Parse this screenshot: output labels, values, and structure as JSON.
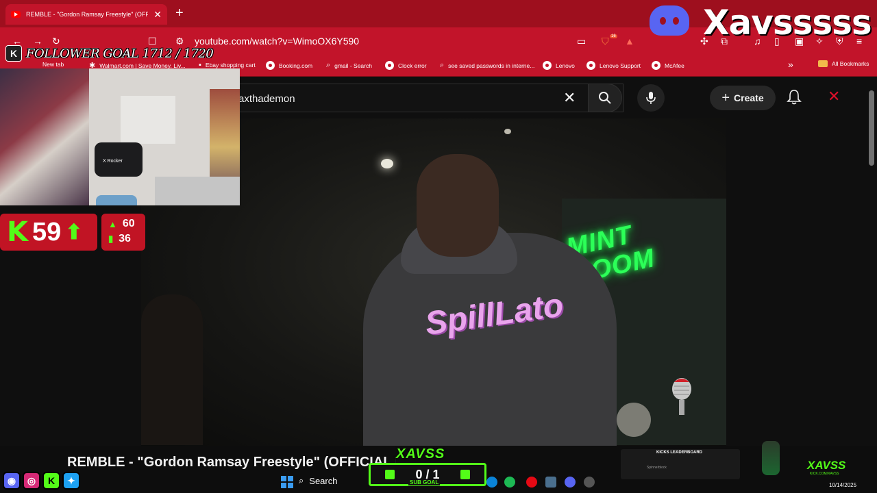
{
  "browser": {
    "tab_title": "REMBLE - \"Gordon Ramsay Freestyle\" (OFFIC",
    "tab_close": "✕",
    "new_tab": "+",
    "url": "youtube.com/watch?v=WimoOX6Y590",
    "extension_badge": "16",
    "bookmarks": [
      {
        "label": "New tab"
      },
      {
        "label": "Walmart.com | Save Money. Liv..."
      },
      {
        "label": "Ebay shopping cart"
      },
      {
        "label": "Booking.com"
      },
      {
        "label": "gmail - Search"
      },
      {
        "label": "Clock error"
      },
      {
        "label": "see saved passwords in interne..."
      },
      {
        "label": "Lenovo"
      },
      {
        "label": "Lenovo Support"
      },
      {
        "label": "McAfee"
      }
    ],
    "all_bookmarks": "All Bookmarks",
    "more_bookmarks": "»"
  },
  "youtube": {
    "search_value": "axthademon",
    "clear_icon": "✕",
    "create_label": "Create",
    "create_plus": "+"
  },
  "video": {
    "neon_sign": "MINT ROOM",
    "hoodie_print": "SpillLato",
    "title": "REMBLE - \"Gordon Ramsay Freestyle\" (OFFICIAL MU"
  },
  "stream_overlay": {
    "follower_goal": "FOLLOWER GOAL 1712 / 1720",
    "kick_letter": "K",
    "chair_brand": "X Rocker",
    "viewer_count": "59",
    "up_arrow": "⬆",
    "stat_peak": "60",
    "stat_avg": "36",
    "sub_goal_count": "0 / 1",
    "sub_goal_label": "SUB GOAL",
    "brand_logo": "XAVSS",
    "leaderboard_title": "KICKS LEADERBOARD",
    "leaderboard_entry": "Spinnerblock",
    "corner_brand": "XAVSS",
    "corner_sub": "KICK.COM/XAVSS",
    "discord_name": "Xavsssss"
  },
  "taskbar": {
    "search_label": "Search",
    "date": "10/14/2025"
  },
  "colors": {
    "browser_red": "#c2142a",
    "kick_green": "#53fc18",
    "discord_blurple": "#5865f2"
  }
}
